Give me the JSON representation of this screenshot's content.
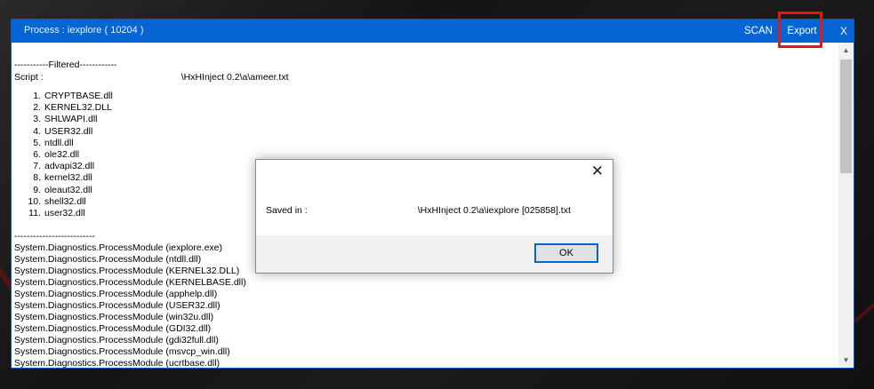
{
  "window": {
    "title": "Process : iexplore ( 10204 )",
    "scan_label": "SCAN",
    "export_label": "Export",
    "close_label": "X"
  },
  "content": {
    "filtered_header": "-----------Filtered------------",
    "script_label": "Script :",
    "script_path": "\\HxHInject 0.2\\a\\ameer.txt",
    "filtered_list": [
      {
        "num": "1.",
        "name": "CRYPTBASE.dll"
      },
      {
        "num": "2.",
        "name": "KERNEL32.DLL"
      },
      {
        "num": "3.",
        "name": "SHLWAPI.dll"
      },
      {
        "num": "4.",
        "name": "USER32.dll"
      },
      {
        "num": "5.",
        "name": "ntdll.dll"
      },
      {
        "num": "6.",
        "name": "ole32.dll"
      },
      {
        "num": "7.",
        "name": "advapi32.dll"
      },
      {
        "num": "8.",
        "name": "kernel32.dll"
      },
      {
        "num": "9.",
        "name": "oleaut32.dll"
      },
      {
        "num": "10.",
        "name": "shell32.dll"
      },
      {
        "num": "11.",
        "name": "user32.dll"
      }
    ],
    "separator": "--------------------------",
    "modules": [
      "System.Diagnostics.ProcessModule (iexplore.exe)",
      "System.Diagnostics.ProcessModule (ntdll.dll)",
      "System.Diagnostics.ProcessModule (KERNEL32.DLL)",
      "System.Diagnostics.ProcessModule (KERNELBASE.dll)",
      "System.Diagnostics.ProcessModule (apphelp.dll)",
      "System.Diagnostics.ProcessModule (USER32.dll)",
      "System.Diagnostics.ProcessModule (win32u.dll)",
      "System.Diagnostics.ProcessModule (GDI32.dll)",
      "System.Diagnostics.ProcessModule (gdi32full.dll)",
      "System.Diagnostics.ProcessModule (msvcp_win.dll)",
      "System.Diagnostics.ProcessModule (ucrtbase.dll)"
    ]
  },
  "dialog": {
    "close_label": "✕",
    "saved_label": "Saved in :",
    "saved_path": "\\HxHInject 0.2\\a\\iexplore [025858].txt",
    "ok_label": "OK"
  },
  "colors": {
    "titlebar": "#0565d4",
    "highlight": "#e01818"
  }
}
